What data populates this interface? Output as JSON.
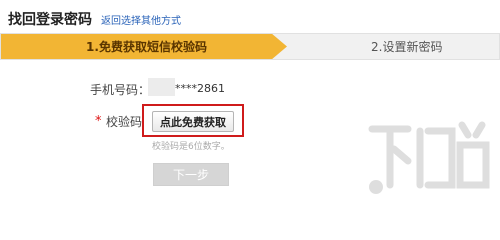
{
  "header": {
    "title": "找回登录密码",
    "back_link": "返回选择其他方式"
  },
  "steps": [
    {
      "label": "1.免费获取短信校验码",
      "active": true
    },
    {
      "label": "2.设置新密码",
      "active": false
    }
  ],
  "form": {
    "phone_label": "手机号码：",
    "phone_value": "****2861",
    "required_mark": "*",
    "code_label": "校验码",
    "get_code_button": "点此免费获取",
    "code_hint": "校验码是6位数字。",
    "next_button": "下一步"
  },
  "colors": {
    "active_step": "#f2b534",
    "highlight_box": "#cf1b1b",
    "link": "#2a63b8"
  },
  "watermark": {
    "text": "下载吧",
    "icon": "watermark-logo-icon"
  }
}
